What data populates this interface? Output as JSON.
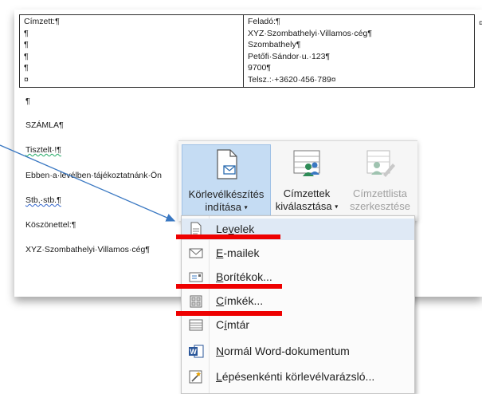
{
  "document": {
    "recipient_lines": [
      "Címzett:¶",
      "¶",
      "¶",
      "¶",
      "¶",
      "¤"
    ],
    "sender_lines": [
      "Feladó:¶",
      "XYZ·Szombathelyi·Villamos·cég¶",
      "Szombathely¶",
      "Petőfi·Sándor·u.·123¶",
      "9700¶",
      "Telsz.:·+3620·456·789¤"
    ],
    "cell_end": "¤",
    "paragraphs": {
      "empty": "¶",
      "invoice": "SZÁMLA¶",
      "greeting": "Tisztelt·!¶",
      "body": "Ebben·a·levélben·tájékoztatnánk·Ön",
      "etc": "Stb,·stb.¶",
      "thanks": "Köszönettel:¶",
      "signature": "XYZ·Szombathelyi·Villamos·cég¶"
    }
  },
  "ribbon": {
    "start_mail_merge": {
      "line1": "Körlevélkészítés",
      "line2": "indítása",
      "caret": "▾"
    },
    "select_recipients": {
      "line1": "Címzettek",
      "line2": "kiválasztása",
      "caret": "▾"
    },
    "edit_recipient_list": {
      "line1": "Címzettlista",
      "line2": "szerkesztése"
    }
  },
  "menu": {
    "items": [
      {
        "label": "Levelek",
        "icon": "letter-icon",
        "hotkey": "v"
      },
      {
        "label": "E-mailek",
        "icon": "envelope-icon",
        "hotkey": "E"
      },
      {
        "label": "Borítékok...",
        "icon": "envelope-label-icon",
        "hotkey": "B"
      },
      {
        "label": "Címkék...",
        "icon": "labels-icon",
        "hotkey": "C"
      },
      {
        "label": "Címtár",
        "icon": "directory-icon",
        "hotkey": "í"
      },
      {
        "label": "Normál Word-dokumentum",
        "icon": "word-document-icon",
        "hotkey": "N"
      },
      {
        "label": "Lépésenkénti körlevélvarázsló...",
        "icon": "wizard-icon",
        "hotkey": "L"
      }
    ],
    "highlighted_index": 0
  },
  "colors": {
    "highlight_red": "#ee0000",
    "arrow_blue": "#3a78c2",
    "active_button": "#c5dcf3",
    "menu_hover": "#dfe9f5"
  }
}
